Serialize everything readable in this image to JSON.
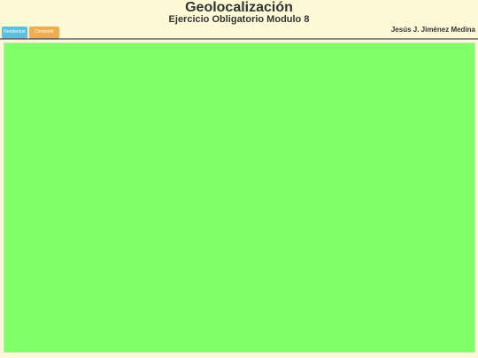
{
  "header": {
    "title": "Geolocalización",
    "subtitle": "Ejercicio Obligatorio Modulo 8",
    "author": "Jesús J. Jiménez Medina"
  },
  "toolbar": {
    "primary_label": "Renderizar",
    "secondary_label": "Compartir"
  },
  "colors": {
    "header_bg": "#fef9d6",
    "primary_button": "#5bc0de",
    "secondary_button": "#f0ad4e",
    "map_bg": "#80ff68"
  }
}
